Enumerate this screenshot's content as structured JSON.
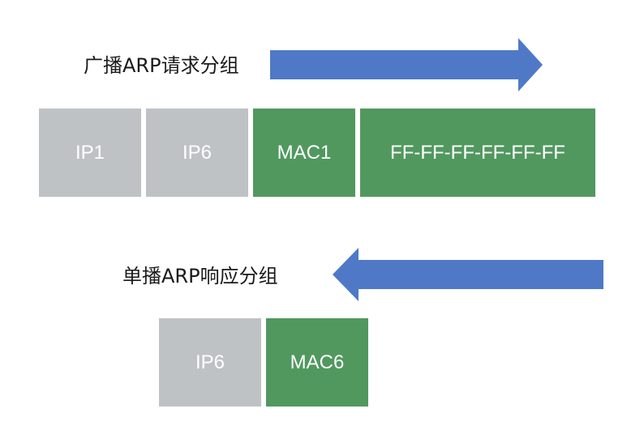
{
  "colors": {
    "arrow": "#4f79c7",
    "ip_cell": "#bfc2c5",
    "mac_cell": "#51985f",
    "cell_text": "#ffffff",
    "label_text": "#1a1a1a"
  },
  "request": {
    "label": "广播ARP请求分组",
    "arrow_direction": "right",
    "fields": [
      "IP1",
      "IP6",
      "MAC1",
      "FF-FF-FF-FF-FF-FF"
    ]
  },
  "reply": {
    "label": "单播ARP响应分组",
    "arrow_direction": "left",
    "fields": [
      "IP6",
      "MAC6"
    ]
  }
}
